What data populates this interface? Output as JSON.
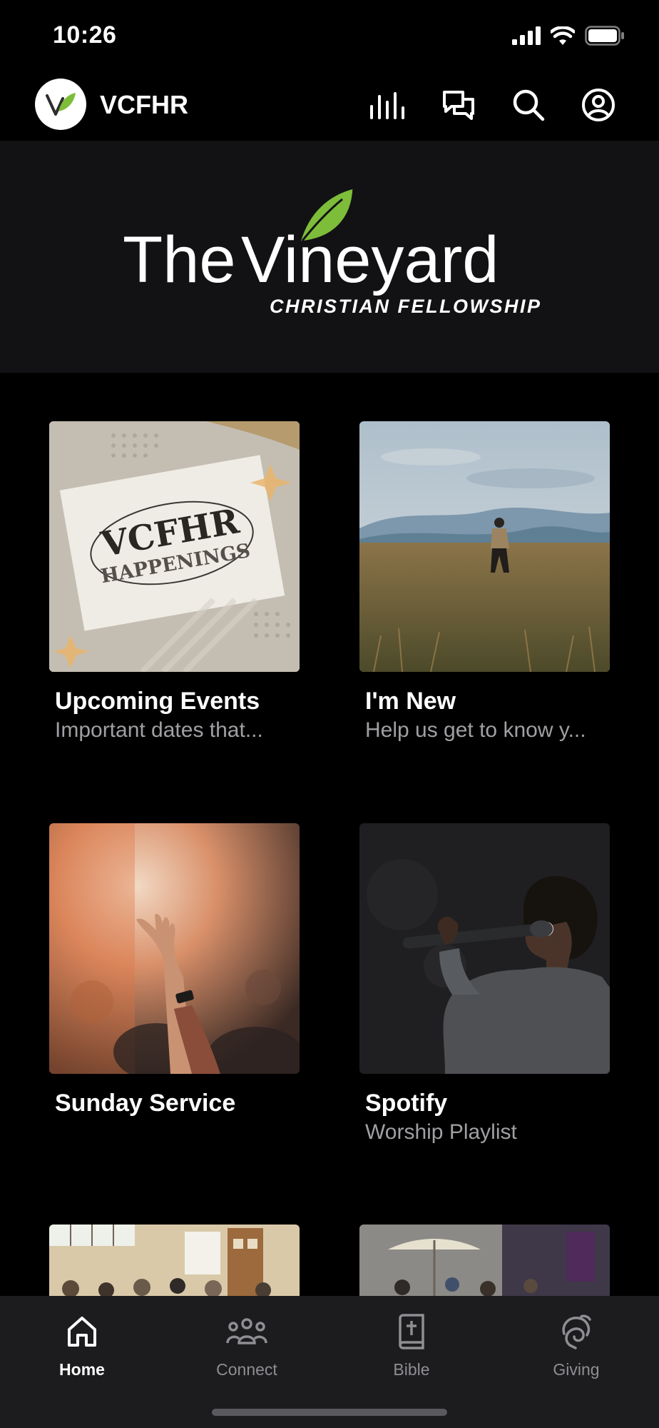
{
  "status": {
    "time": "10:26"
  },
  "header": {
    "app_name": "VCFHR",
    "icons": [
      "chart-icon",
      "chat-icon",
      "search-icon",
      "profile-icon"
    ]
  },
  "banner": {
    "logo_line1_a": "The",
    "logo_line1_b": "Vineyard",
    "logo_line2": "CHRISTIAN FELLOWSHIP",
    "leaf_color": "#7dbd3a"
  },
  "tiles": [
    {
      "title": "Upcoming Events",
      "subtitle": "Important dates that...",
      "art_line1": "VCFHR",
      "art_line2": "HAPPENINGS"
    },
    {
      "title": "I'm New",
      "subtitle": "Help us get to know y..."
    },
    {
      "title": "Sunday Service",
      "subtitle": ""
    },
    {
      "title": "Spotify",
      "subtitle": "Worship Playlist"
    }
  ],
  "nav": {
    "items": [
      {
        "label": "Home",
        "icon": "home-icon",
        "active": true
      },
      {
        "label": "Connect",
        "icon": "people-icon",
        "active": false
      },
      {
        "label": "Bible",
        "icon": "bible-icon",
        "active": false
      },
      {
        "label": "Giving",
        "icon": "giving-icon",
        "active": false
      }
    ]
  }
}
